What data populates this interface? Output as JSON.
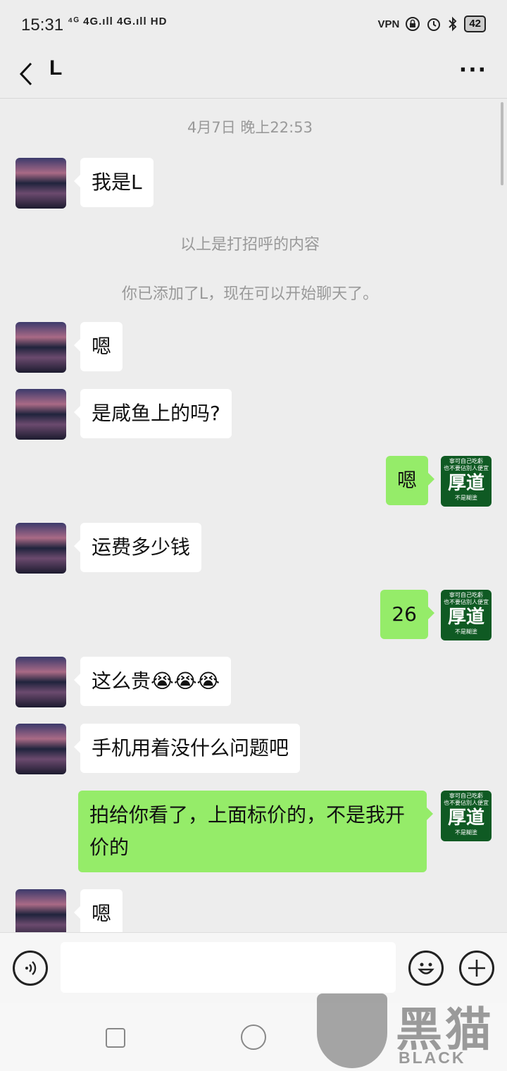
{
  "status": {
    "time": "15:31",
    "network": "⁴ᴳ 4G.ıll 4G.ıll HD",
    "icons": [
      "vpn-icon",
      "lock-icon",
      "alarm-icon",
      "bluetooth-icon"
    ],
    "vpn": "VPN",
    "battery": "42"
  },
  "nav": {
    "back_icon": "chevron-left-icon",
    "title": "L",
    "more": "···"
  },
  "chat": {
    "timestamp": "4月7日 晚上22:53",
    "greeting_note": "以上是打招呼的内容",
    "added_note": "你已添加了L，现在可以开始聊天了。",
    "messages": [
      {
        "side": "left",
        "text": "我是L"
      },
      {
        "side": "left",
        "text": "嗯"
      },
      {
        "side": "left",
        "text": "是咸鱼上的吗?"
      },
      {
        "side": "right",
        "text": "嗯"
      },
      {
        "side": "left",
        "text": "运费多少钱"
      },
      {
        "side": "right",
        "text": "26"
      },
      {
        "side": "left",
        "text": "这么贵😭😭😭"
      },
      {
        "side": "left",
        "text": "手机用着没什么问题吧"
      },
      {
        "side": "right",
        "text": "拍给你看了，上面标价的，不是我开价的"
      },
      {
        "side": "left",
        "text": "嗯"
      }
    ],
    "my_avatar": {
      "line1": "寧可自己吃虧",
      "line2": "也不要佔別人便宜",
      "big": "厚道",
      "line3": "不是糊塗"
    }
  },
  "input_bar": {
    "voice_icon": "voice-icon",
    "emoji_icon": "emoji-icon",
    "plus_icon": "plus-icon"
  },
  "watermark": {
    "zh": "黑猫",
    "en": "BLACK CAT"
  }
}
